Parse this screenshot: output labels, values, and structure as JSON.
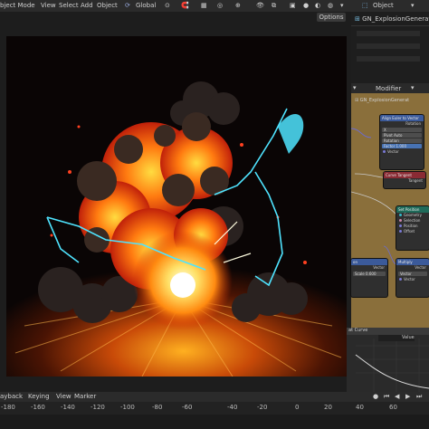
{
  "header": {
    "mode": "bject Mode",
    "menus": [
      "View",
      "Select",
      "Add",
      "Object"
    ],
    "transform": "Global",
    "right_mode": "Object",
    "options": "Options"
  },
  "outliner": {
    "item": "GN_ExplosionGenerator"
  },
  "node_editor": {
    "header_label": "Modifier",
    "tree_name": "GN_ExplosionGenerat",
    "nodes": {
      "align": {
        "title": "Align Euler to Vector",
        "rows": [
          "Rotation",
          "X",
          "Y",
          "Z"
        ],
        "fields": [
          "Pivot",
          "Auto",
          "Factor",
          "1.000"
        ],
        "footer": "Vector"
      },
      "tangent": {
        "title": "Curve Tangent",
        "rows": [
          "Tangent"
        ]
      },
      "position": {
        "title": "Set Position",
        "rows": [
          "Geometry",
          "Selection",
          "Position",
          "Offset"
        ]
      },
      "multiply": {
        "title": "Multiply",
        "rows": [
          "Vector",
          "Vector",
          "Vector"
        ]
      },
      "left": {
        "title": "on",
        "rows": [
          "Vector",
          "Scale",
          "0.600"
        ]
      }
    }
  },
  "curve_panel": {
    "title": "at Curve",
    "value": "Value"
  },
  "timeline": {
    "menus": [
      "ayback",
      "Keying",
      "View",
      "Marker"
    ],
    "ticks": [
      "-180",
      "-160",
      "-140",
      "-120",
      "-100",
      "-80",
      "-60",
      "-40",
      "-20",
      "0",
      "20",
      "40",
      "60"
    ]
  },
  "colors": {
    "node_editor_bg": "#8a6f3b",
    "viewport_bg": "#0a0505",
    "explosion_core": "#ffe066",
    "lightning": "#4fe4ff"
  }
}
